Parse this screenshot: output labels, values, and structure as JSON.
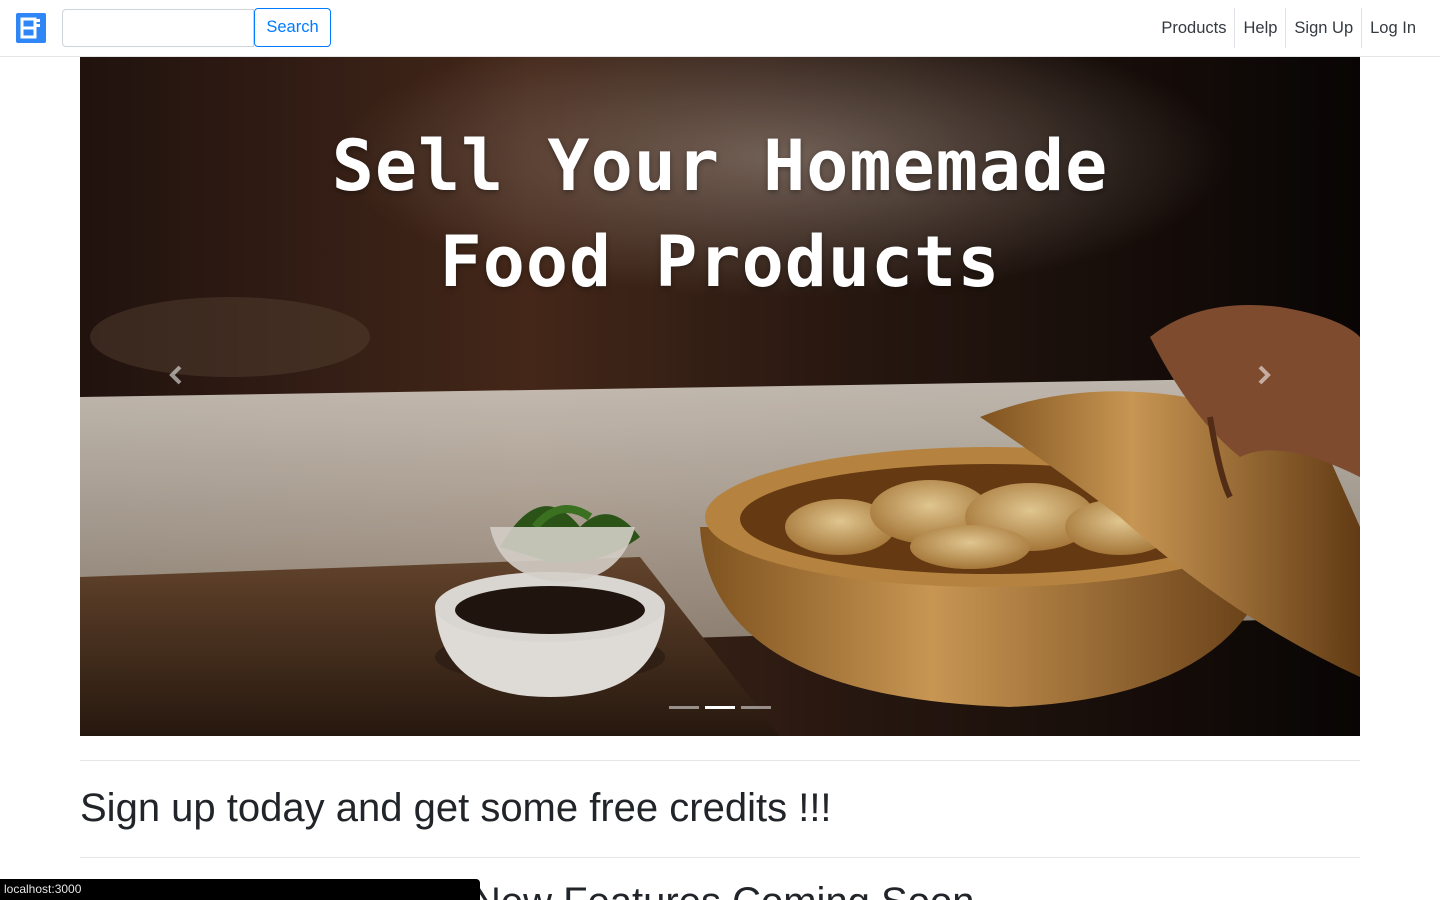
{
  "header": {
    "logo_icon": "app-logo-icon",
    "search": {
      "value": "",
      "placeholder": ""
    },
    "search_button_label": "Search",
    "nav": [
      "Products",
      "Help",
      "Sign Up",
      "Log In"
    ],
    "accent_color": "#007bff"
  },
  "carousel": {
    "headline_line1": "Sell Your Homemade",
    "headline_line2": "Food Products",
    "prev_icon": "chevron-left-icon",
    "next_icon": "chevron-right-icon",
    "slide_count": 3,
    "active_slide": 2
  },
  "content": {
    "promo_heading": "Sign up today and get some free credits !!!",
    "next_heading": "New Features Coming Soon"
  },
  "status_bar": {
    "url": "localhost:3000"
  }
}
